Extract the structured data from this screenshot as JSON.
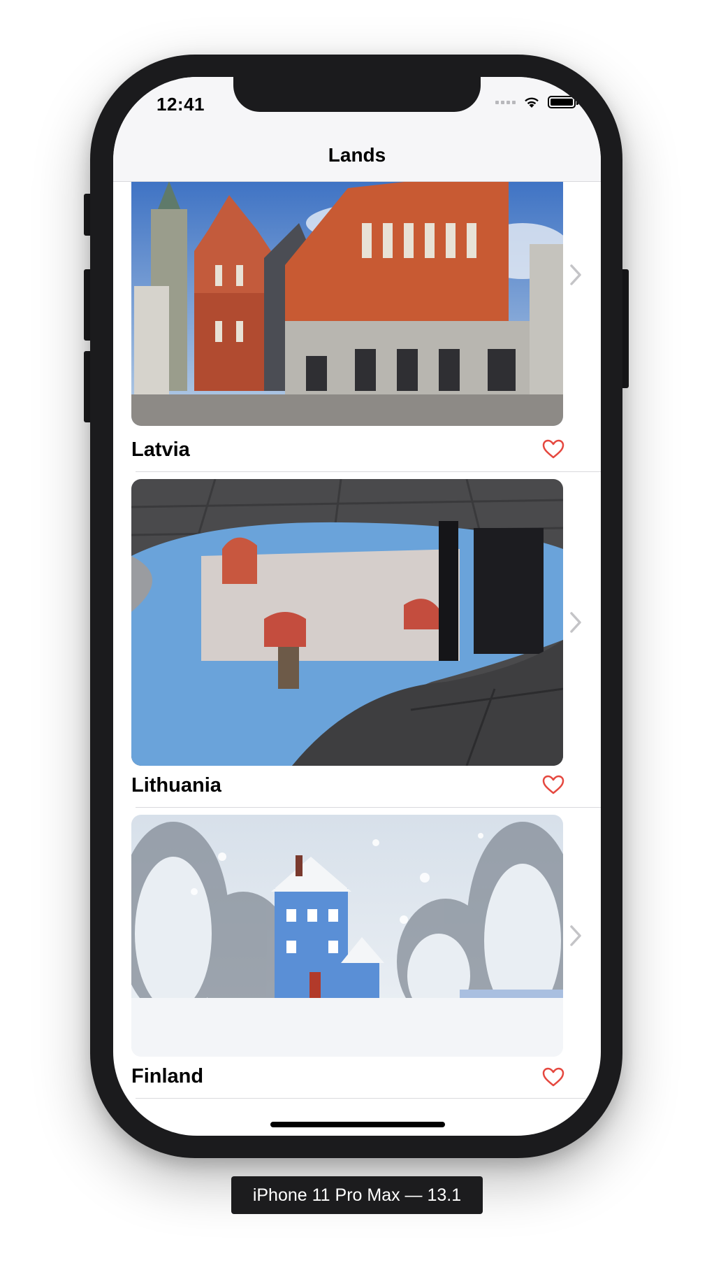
{
  "status_bar": {
    "time": "12:41",
    "icons": [
      "cellular-icon",
      "wifi-icon",
      "battery-icon"
    ]
  },
  "nav": {
    "title": "Lands"
  },
  "list": [
    {
      "name": "Latvia",
      "favorite_icon": "heart-outline-icon",
      "accessory": "chevron-right-icon",
      "image": "riga-house-of-blackheads"
    },
    {
      "name": "Lithuania",
      "favorite_icon": "heart-outline-icon",
      "accessory": "chevron-right-icon",
      "image": "puddle-reflection-church"
    },
    {
      "name": "Finland",
      "favorite_icon": "heart-outline-icon",
      "accessory": "chevron-right-icon",
      "image": "moomin-house-snow"
    }
  ],
  "simulator": {
    "label": "iPhone 11 Pro Max — 13.1"
  },
  "colors": {
    "heart": "#e5483f",
    "chevron": "#c4c4c7",
    "separator": "#d9d9dd",
    "nav_bg": "#f6f6f8"
  }
}
